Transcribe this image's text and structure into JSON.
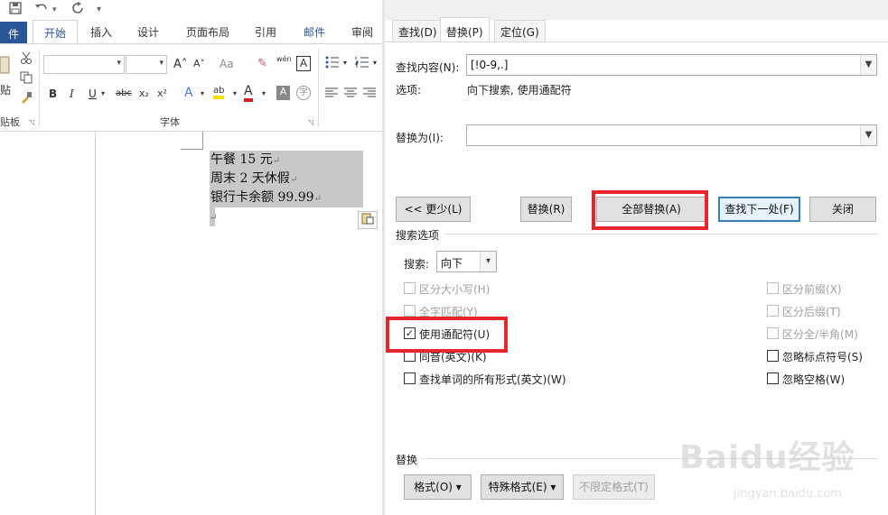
{
  "word": {
    "quick_access": {
      "save_icon": "save-icon",
      "undo_icon": "undo-icon",
      "redo_icon": "redo-icon",
      "customize": "▾"
    },
    "tabs": {
      "file": "件",
      "home": "开始",
      "insert": "插入",
      "design": "设计",
      "layout": "页面布局",
      "references": "引用",
      "mailings": "邮件",
      "review": "审阅"
    },
    "ribbon": {
      "paste_partial": "贴",
      "clipboard_partial": "贴板",
      "font_group": "字体",
      "font_tools": {
        "grow": "A˄",
        "shrink": "A˅",
        "case": "Aa",
        "clear": "✎",
        "phonetic": "wén",
        "border": "A",
        "bold": "B",
        "italic": "I",
        "underline": "U",
        "strike": "abc",
        "sub": "x₂",
        "sup": "x²",
        "effects": "A",
        "highlight": "ab",
        "color": "A",
        "shade": "A",
        "enclose": "字"
      }
    },
    "document": {
      "lines": [
        "午餐 15 元",
        "周末 2 天休假",
        "银行卡余额 99.99"
      ],
      "para_mark": "↵"
    }
  },
  "dialog": {
    "tabs": {
      "find": "查找(D)",
      "replace": "替换(P)",
      "goto": "定位(G)"
    },
    "find_label": "查找内容(N):",
    "find_value": "[!0-9,.]",
    "options_label": "选项:",
    "options_value": "向下搜索, 使用通配符",
    "replace_label": "替换为(I):",
    "replace_value": "",
    "buttons": {
      "less": "<< 更少(L)",
      "replace": "替换(R)",
      "replace_all": "全部替换(A)",
      "find_next": "查找下一处(F)",
      "close": "关闭"
    },
    "search_options_title": "搜索选项",
    "search_label": "搜索:",
    "search_value": "向下",
    "left_options": [
      {
        "label": "区分大小写(H)",
        "checked": false,
        "disabled": true
      },
      {
        "label": "全字匹配(Y)",
        "checked": false,
        "disabled": true
      },
      {
        "label": "使用通配符(U)",
        "checked": true,
        "disabled": false
      },
      {
        "label": "同音(英文)(K)",
        "checked": false,
        "disabled": false
      },
      {
        "label": "查找单词的所有形式(英文)(W)",
        "checked": false,
        "disabled": false
      }
    ],
    "right_options": [
      {
        "label": "区分前缀(X)",
        "checked": false,
        "disabled": true
      },
      {
        "label": "区分后缀(T)",
        "checked": false,
        "disabled": true
      },
      {
        "label": "区分全/半角(M)",
        "checked": false,
        "disabled": true
      },
      {
        "label": "忽略标点符号(S)",
        "checked": false,
        "disabled": false
      },
      {
        "label": "忽略空格(W)",
        "checked": false,
        "disabled": false
      }
    ],
    "replace_section_title": "替换",
    "bottom_buttons": {
      "format": "格式(O) ▾",
      "special": "特殊格式(E) ▾",
      "no_format": "不限定格式(T)"
    },
    "checkmark": "✓"
  },
  "watermark": {
    "brand": "Baidu经验",
    "url": "jingyan.baidu.com"
  },
  "colors": {
    "highlight_box": "#e8252a",
    "file_tab": "#2b579a",
    "selection": "#c8c8c8"
  }
}
